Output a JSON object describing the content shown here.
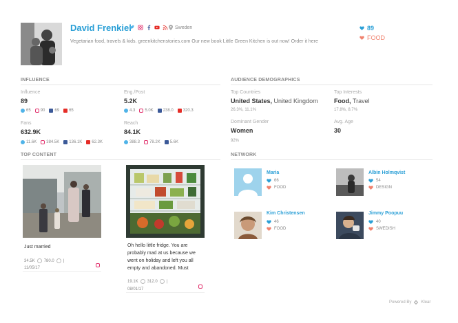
{
  "profile": {
    "name": "David Frenkiel",
    "location": "Sweden",
    "bio": "Vegetarian food, travels & kids. greenkitchenstories.com Our new book Little Green Kitchen is out now! Order it here",
    "score": "89",
    "tag": "FOOD"
  },
  "influence": {
    "title": "INFLUENCE",
    "influence_label": "Influence",
    "influence_value": "89",
    "influence_stats": [
      "65",
      "90",
      "69",
      "65"
    ],
    "eng_label": "Eng./Post",
    "eng_value": "5.2K",
    "eng_stats": [
      "4.3",
      "5.0K",
      "238.0",
      "320.3"
    ],
    "fans_label": "Fans",
    "fans_value": "632.9K",
    "fans_stats": [
      "11.6K",
      "384.5K",
      "136.1K",
      "62.3K"
    ],
    "reach_label": "Reach",
    "reach_value": "84.1K",
    "reach_stats": [
      "388.3",
      "78.2K",
      "5.6K"
    ]
  },
  "demographics": {
    "title": "AUDIENCE DEMOGRAPHICS",
    "countries_label": "Top Countries",
    "countries_value_1": "United States,",
    "countries_value_2": "United Kingdom",
    "countries_pct": "26.3%, 11.1%",
    "interests_label": "Top Interests",
    "interests_value_1": "Food,",
    "interests_value_2": "Travel",
    "interests_pct": "17.8%, 8.7%",
    "gender_label": "Dominant Gender",
    "gender_value": "Women",
    "gender_pct": "92%",
    "age_label": "Avg. Age",
    "age_value": "30"
  },
  "top_content": {
    "title": "TOP CONTENT",
    "posts": [
      {
        "caption": "Just married",
        "likes": "34.5K",
        "comments": "780.0",
        "date": "11/05/17"
      },
      {
        "caption": "Oh hello little fridge. You are probably mad at us because we went on holiday and left you all empty and abandoned. Must",
        "likes": "19.1K",
        "comments": "312.0",
        "date": "08/01/17"
      }
    ]
  },
  "network": {
    "title": "NETWORK",
    "people": [
      {
        "name": "Maria",
        "score": "66",
        "tag": "FOOD"
      },
      {
        "name": "Albin Holmqvist",
        "score": "54",
        "tag": "DESIGN"
      },
      {
        "name": "Kim Christensen",
        "score": "46",
        "tag": "FOOD"
      },
      {
        "name": "Jimmy Poopuu",
        "score": "40",
        "tag": "SWEDISH"
      }
    ]
  },
  "footer": {
    "powered": "Powered By",
    "brand": "Klear"
  },
  "colors": {
    "accent": "#2a9fd6",
    "tag": "#f0826e",
    "twitter": "#4fb3e8",
    "instagram": "#e1306c",
    "facebook": "#3b5998",
    "youtube": "#e52d27"
  }
}
